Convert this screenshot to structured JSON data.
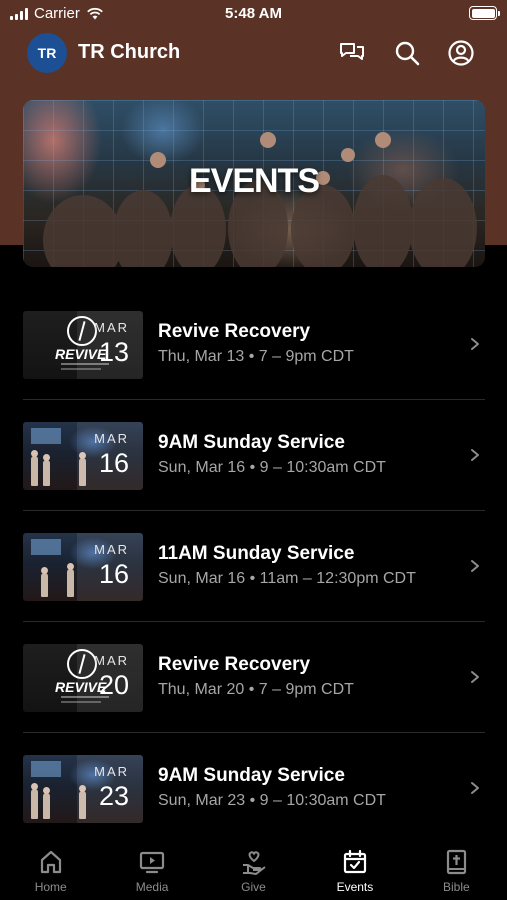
{
  "status_bar": {
    "carrier": "Carrier",
    "time": "5:48 AM"
  },
  "header": {
    "avatar_initials": "TR",
    "title": "TR Church"
  },
  "banner": {
    "title": "EVENTS"
  },
  "events": [
    {
      "month": "MAR",
      "day": "13",
      "title": "Revive Recovery",
      "time": "Thu, Mar 13 • 7 – 9pm CDT",
      "thumb_text": "REVIVE"
    },
    {
      "month": "MAR",
      "day": "16",
      "title": "9AM Sunday Service",
      "time": "Sun, Mar 16 • 9 – 10:30am CDT"
    },
    {
      "month": "MAR",
      "day": "16",
      "title": "11AM Sunday Service",
      "time": "Sun, Mar 16 • 11am – 12:30pm CDT"
    },
    {
      "month": "MAR",
      "day": "20",
      "title": "Revive Recovery",
      "time": "Thu, Mar 20 • 7 – 9pm CDT",
      "thumb_text": "REVIVE"
    },
    {
      "month": "MAR",
      "day": "23",
      "title": "9AM Sunday Service",
      "time": "Sun, Mar 23 • 9 – 10:30am CDT"
    }
  ],
  "tabs": [
    {
      "label": "Home",
      "icon": "home-icon",
      "active": false
    },
    {
      "label": "Media",
      "icon": "media-icon",
      "active": false
    },
    {
      "label": "Give",
      "icon": "give-icon",
      "active": false
    },
    {
      "label": "Events",
      "icon": "calendar-icon",
      "active": true
    },
    {
      "label": "Bible",
      "icon": "bible-icon",
      "active": false
    }
  ],
  "colors": {
    "header_bg": "#5a3226",
    "avatar_bg": "#1d4f95",
    "background": "#000000",
    "secondary_text": "#a6a6a6",
    "inactive_tab": "#8c8c8c"
  }
}
